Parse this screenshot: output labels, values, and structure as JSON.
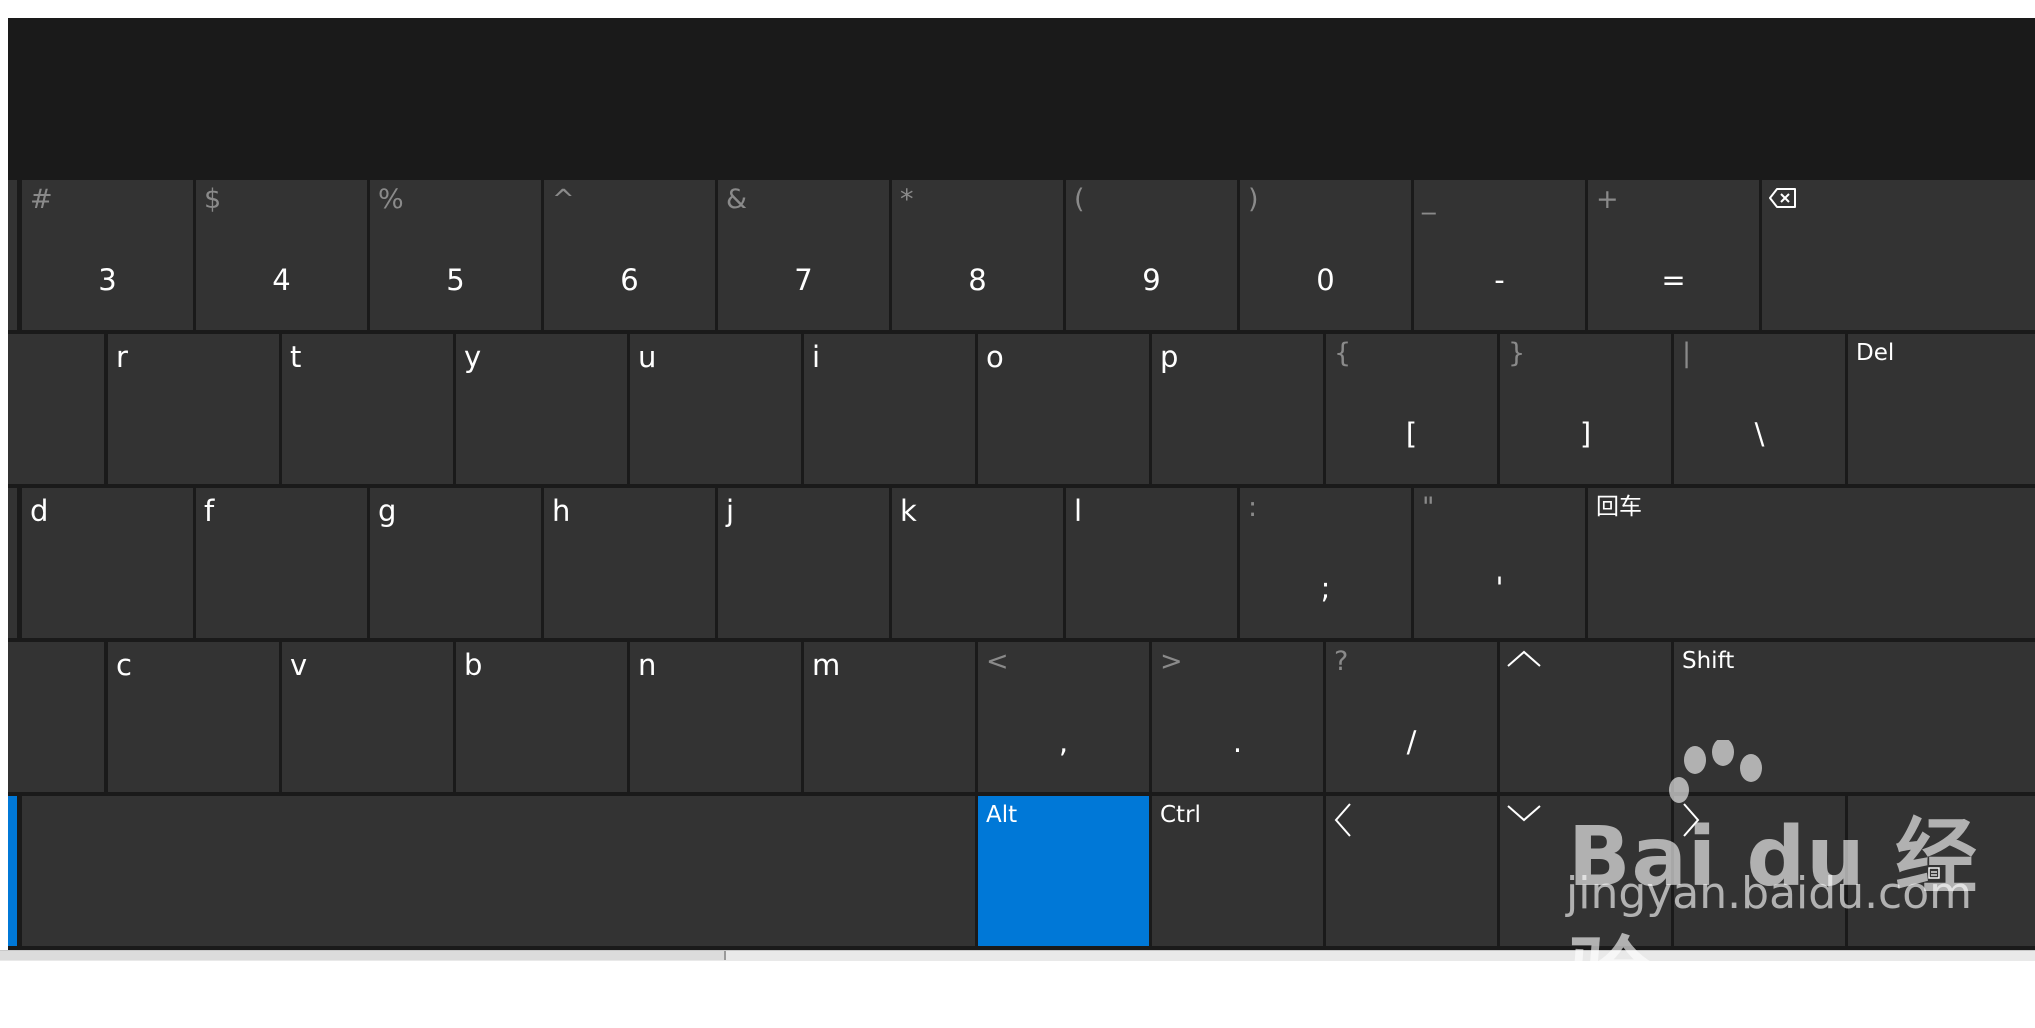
{
  "keyboard": {
    "row1": [
      {
        "shift": "#",
        "main": "3"
      },
      {
        "shift": "$",
        "main": "4"
      },
      {
        "shift": "%",
        "main": "5"
      },
      {
        "shift": "^",
        "main": "6"
      },
      {
        "shift": "&",
        "main": "7"
      },
      {
        "shift": "*",
        "main": "8"
      },
      {
        "shift": "(",
        "main": "9"
      },
      {
        "shift": ")",
        "main": "0"
      },
      {
        "shift": "_",
        "main": "-"
      },
      {
        "shift": "+",
        "main": "="
      }
    ],
    "row2": [
      {
        "label": "r"
      },
      {
        "label": "t"
      },
      {
        "label": "y"
      },
      {
        "label": "u"
      },
      {
        "label": "i"
      },
      {
        "label": "o"
      },
      {
        "label": "p"
      }
    ],
    "row2_symbols": [
      {
        "shift": "{",
        "main": "["
      },
      {
        "shift": "}",
        "main": "]"
      },
      {
        "shift": "|",
        "main": "\\"
      }
    ],
    "del_label": "Del",
    "row3": [
      {
        "label": "d"
      },
      {
        "label": "f"
      },
      {
        "label": "g"
      },
      {
        "label": "h"
      },
      {
        "label": "j"
      },
      {
        "label": "k"
      },
      {
        "label": "l"
      }
    ],
    "row3_symbols": [
      {
        "shift": ":",
        "main": ";"
      },
      {
        "shift": "\"",
        "main": "'"
      }
    ],
    "enter_label": "回车",
    "row4": [
      {
        "label": "c"
      },
      {
        "label": "v"
      },
      {
        "label": "b"
      },
      {
        "label": "n"
      },
      {
        "label": "m"
      }
    ],
    "row4_symbols": [
      {
        "shift": "<",
        "main": ","
      },
      {
        "shift": ">",
        "main": "."
      },
      {
        "shift": "?",
        "main": "/"
      }
    ],
    "shift_label": "Shift",
    "alt_label": "Alt",
    "ctrl_label": "Ctrl",
    "accent_color": "#0078d7"
  },
  "watermark": {
    "logo_text": "Bai du 经验",
    "url_text": "jingyan.baidu.com"
  }
}
